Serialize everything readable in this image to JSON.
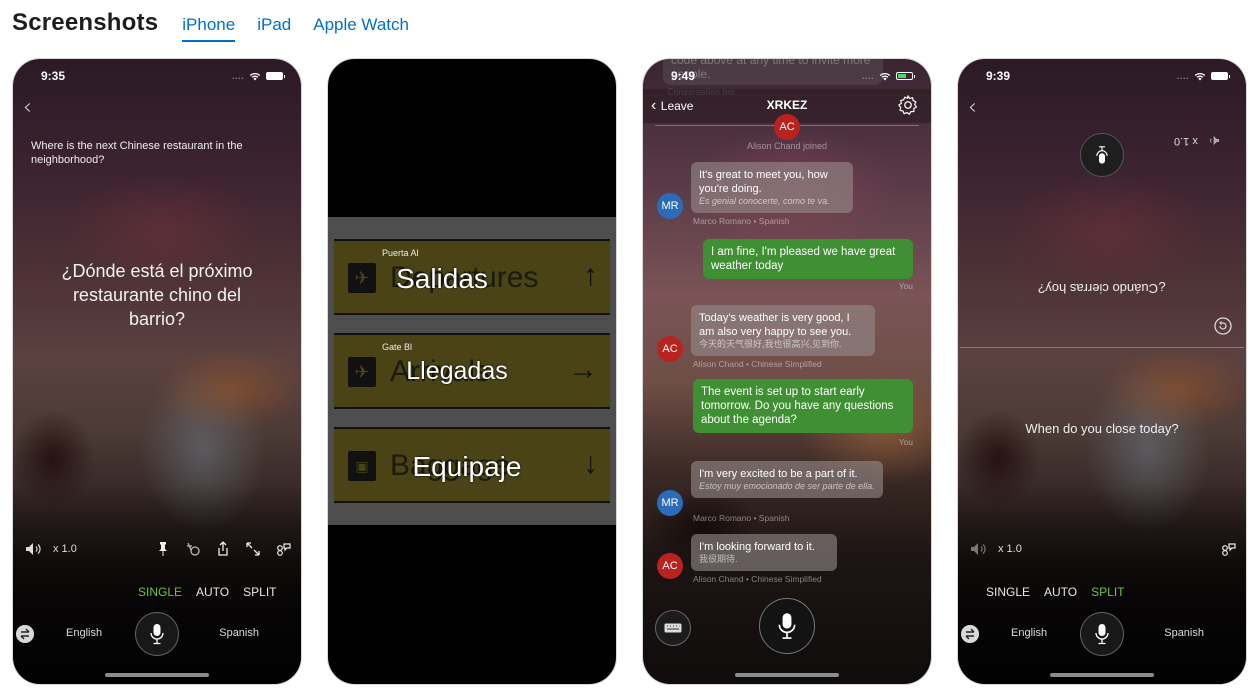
{
  "header": {
    "title": "Screenshots",
    "tabs": [
      {
        "label": "iPhone",
        "active": true
      },
      {
        "label": "iPad",
        "active": false
      },
      {
        "label": "Apple Watch",
        "active": false
      }
    ],
    "accent_color": "#0070c9"
  },
  "screens": {
    "single": {
      "time": "9:35",
      "source_text": "Where is the next Chinese restaurant in the neighborhood?",
      "translated_text": "¿Dónde está el próximo restaurante chino del barrio?",
      "speed": "x 1.0",
      "modes": [
        "SINGLE",
        "AUTO",
        "SPLIT"
      ],
      "active_mode": "SINGLE",
      "source_language": "English",
      "target_language": "Spanish",
      "toolbar_icons": [
        "pin-icon",
        "translate-icon",
        "share-icon",
        "expand-icon",
        "conversation-icon"
      ],
      "active_color": "#6cc04a"
    },
    "camera": {
      "signs": [
        {
          "label": "Puerta Al",
          "original": "Departures",
          "translation": "Salidas",
          "glyph": "airplane-icon",
          "arrow": "↑"
        },
        {
          "label": "Gate Bl",
          "original": "Arrivals",
          "translation": "Llegadas",
          "glyph": "airplane-icon",
          "arrow": "→"
        },
        {
          "label": "",
          "original": "Baggage",
          "translation": "Equipaje",
          "glyph": "suitcase-icon",
          "arrow": "↓"
        }
      ]
    },
    "conversation": {
      "time": "9:49",
      "previous_message": "code above at any time to invite more people.",
      "previous_sender": "Conversation bot",
      "back_label": "Leave",
      "room_code": "XRKEZ",
      "joined_avatar": "AC",
      "joined_text": "Alison Chand joined",
      "messages": [
        {
          "direction": "in",
          "avatar": "MR",
          "text": "It's great to meet you, how you're doing.",
          "translation": "Es genial conocerte, como te va.",
          "meta": "Marco Romano • Spanish"
        },
        {
          "direction": "out",
          "text": "I am fine, I'm pleased we have great weather today",
          "meta": "You"
        },
        {
          "direction": "in",
          "avatar": "AC",
          "text": "Today's weather is very good, I am also very happy to see you.",
          "translation": "今天的天气很好,我也很高兴,见到你.",
          "meta": "Alison Chand • Chinese Simplified"
        },
        {
          "direction": "out",
          "text": "The event is set up to start early tomorrow. Do you have any questions about the agenda?",
          "meta": "You"
        },
        {
          "direction": "in",
          "avatar": "MR",
          "text": "I'm very excited to be a part of it.",
          "translation": "Estoy muy emocionado de ser parte de ella.",
          "meta": "Marco Romano • Spanish"
        },
        {
          "direction": "in",
          "avatar": "AC",
          "text": "I'm looking forward to it.",
          "translation": "我很期待.",
          "meta": "Alison Chand • Chinese Simplified"
        }
      ]
    },
    "split": {
      "time": "9:39",
      "top_speed": "x 1.0",
      "top_text_flipped": "¿Cuándo cierras hoy?",
      "bottom_text": "When do you close today?",
      "speed": "x 1.0",
      "modes": [
        "SINGLE",
        "AUTO",
        "SPLIT"
      ],
      "active_mode": "SPLIT",
      "source_language": "English",
      "target_language": "Spanish"
    }
  }
}
